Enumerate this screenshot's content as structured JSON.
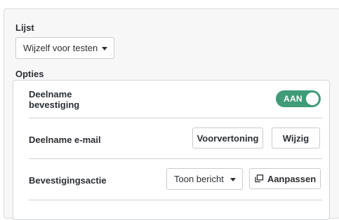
{
  "list_section": {
    "label": "Lijst",
    "selected_value": "Wijzelf voor testen"
  },
  "options_section": {
    "label": "Opties",
    "participation_confirmation": {
      "label": "Deelname\nbevestiging",
      "toggle_text": "AAN",
      "toggle_state": "on"
    },
    "participation_email": {
      "label": "Deelname e-mail",
      "preview_label": "Voorvertoning",
      "edit_label": "Wijzig"
    },
    "confirmation_action": {
      "label": "Bevestigingsactie",
      "selected_value": "Toon bericht",
      "customize_label": "Aanpassen"
    }
  },
  "colors": {
    "toggle_on": "#3f9b78",
    "panel_bg": "#f7f7f8",
    "card_border": "#d4d6d9"
  }
}
